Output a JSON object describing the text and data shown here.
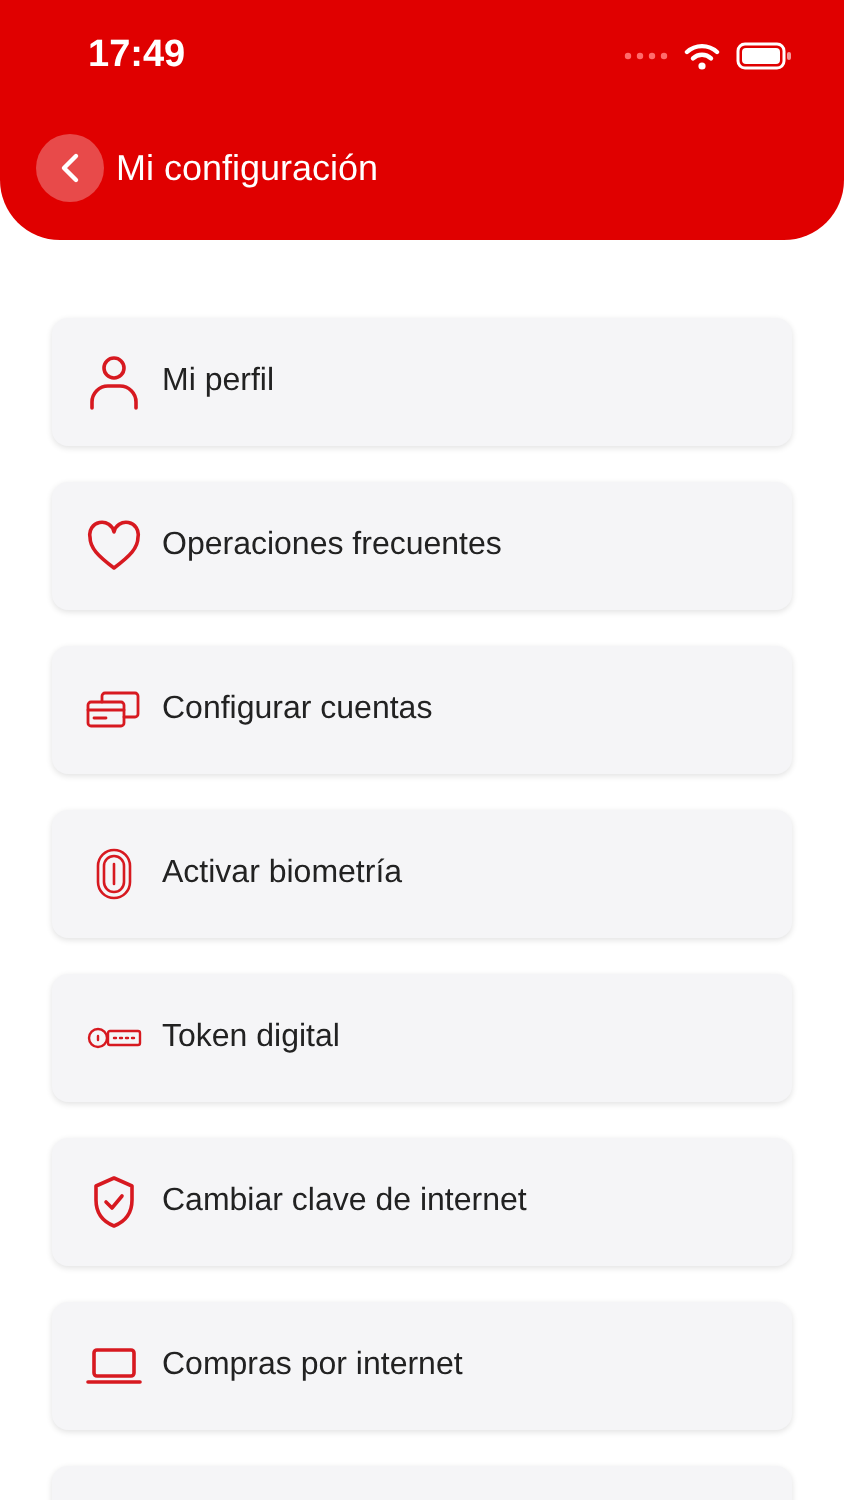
{
  "status_bar": {
    "time": "17:49"
  },
  "header": {
    "title": "Mi configuración"
  },
  "menu": [
    {
      "kind": "person",
      "label": "Mi perfil"
    },
    {
      "kind": "heart",
      "label": "Operaciones frecuentes"
    },
    {
      "kind": "cards",
      "label": "Configurar cuentas"
    },
    {
      "kind": "fingerprint",
      "label": "Activar biometría"
    },
    {
      "kind": "token",
      "label": "Token digital"
    },
    {
      "kind": "shield",
      "label": "Cambiar clave de internet"
    },
    {
      "kind": "laptop",
      "label": "Compras por internet"
    }
  ]
}
